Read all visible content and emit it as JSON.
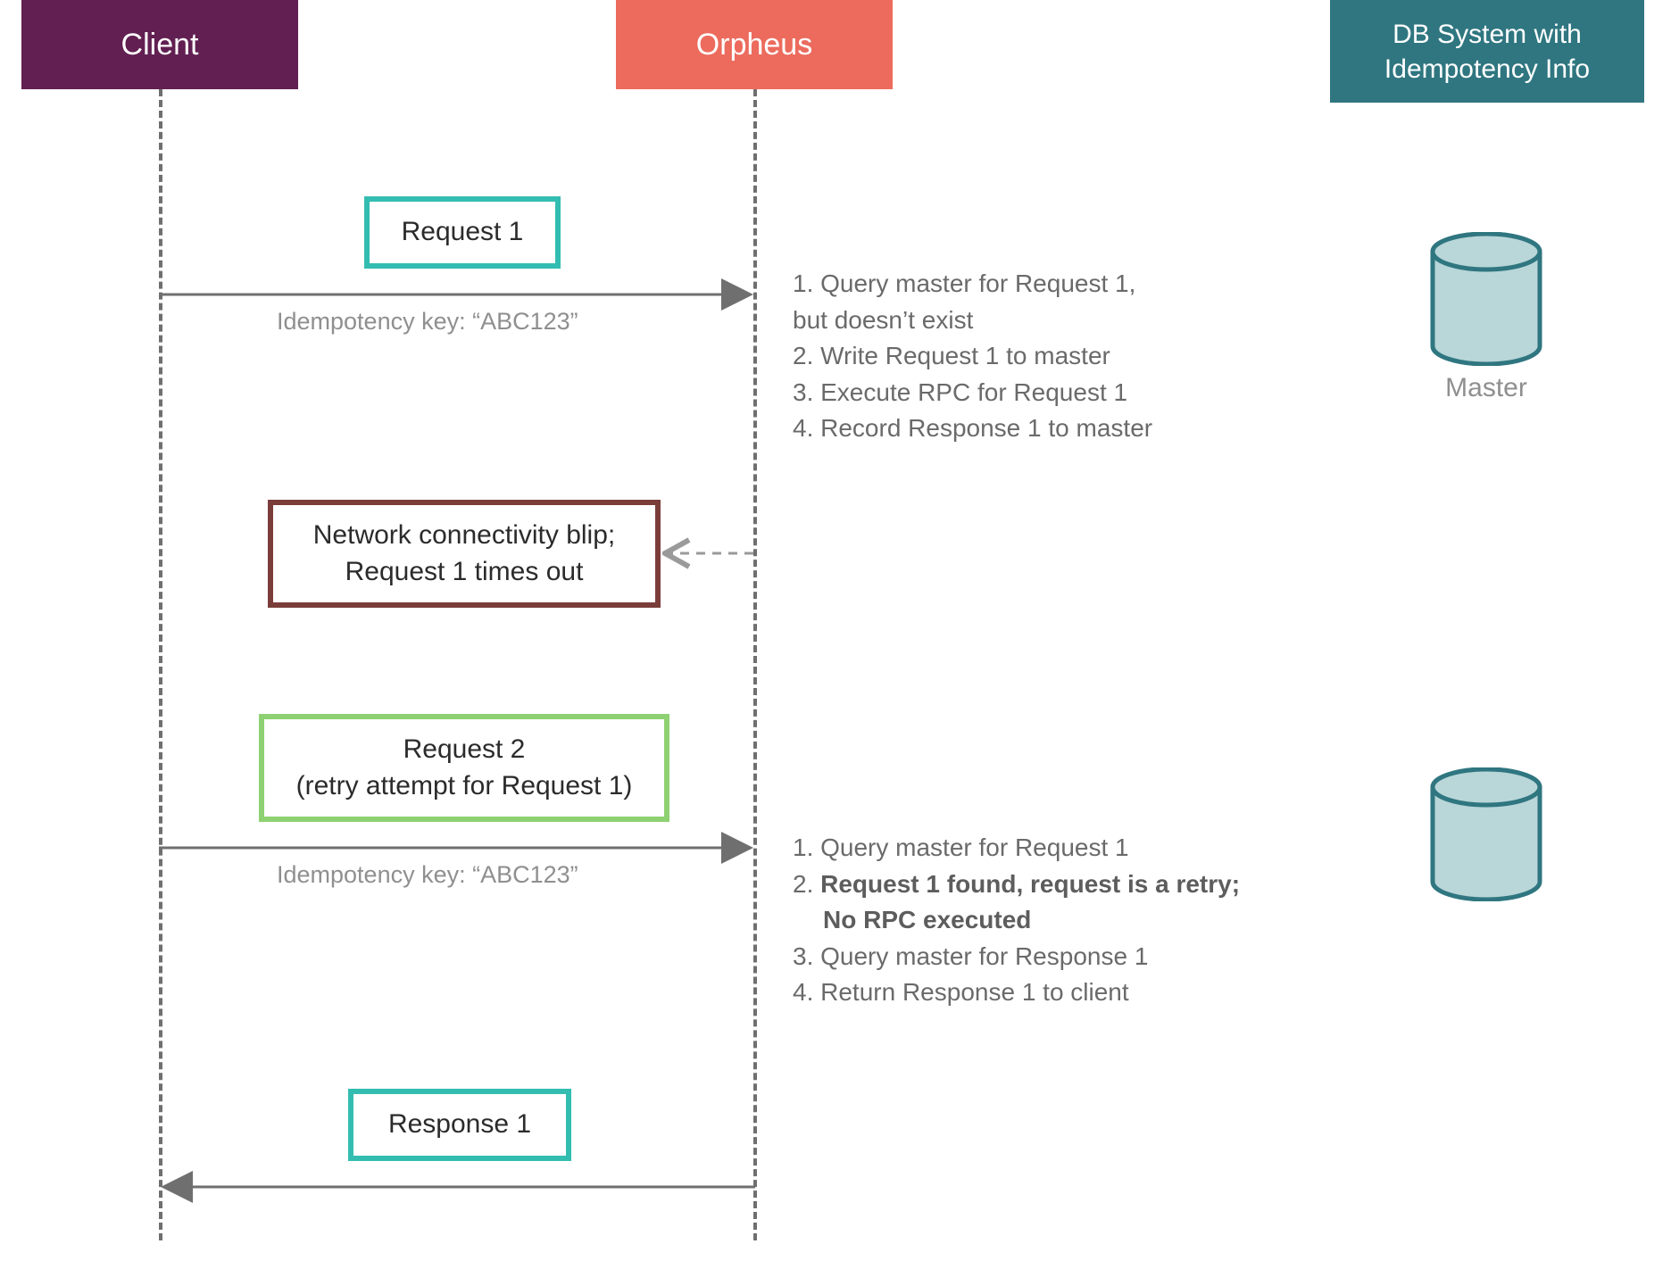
{
  "participants": {
    "client": "Client",
    "orpheus": "Orpheus",
    "db": "DB System with Idempotency Info"
  },
  "messages": {
    "request1": "Request 1",
    "request1_key": "Idempotency key: “ABC123”",
    "network_blip_line1": "Network connectivity blip;",
    "network_blip_line2": "Request 1 times out",
    "request2_line1": "Request 2",
    "request2_line2": "(retry attempt for Request 1)",
    "request2_key": "Idempotency key: “ABC123”",
    "response1": "Response 1"
  },
  "steps1": {
    "s1_line1": "1. Query master for Request 1,",
    "s1_line2": "but doesn’t exist",
    "s2": "2. Write Request 1 to master",
    "s3": "3. Execute RPC for Request 1",
    "s4": "4. Record Response 1 to master"
  },
  "steps2": {
    "s1": "1. Query master for Request 1",
    "s2_line1": "2.",
    "s2_bold_line1": "Request 1 found, request is a retry;",
    "s2_bold_line2": "No RPC executed",
    "s3": "3. Query master for Response 1",
    "s4": "4. Return Response 1 to client"
  },
  "db_labels": {
    "master": "Master"
  },
  "colors": {
    "client": "#611f52",
    "orpheus": "#ec6b5d",
    "db": "#2f7680",
    "teal": "#33bdb1",
    "green": "#8ed172",
    "maroon": "#7a3d3a",
    "arrow": "#6f6f6f",
    "cyl_fill": "#b9d6d9",
    "cyl_stroke": "#2f7680"
  }
}
